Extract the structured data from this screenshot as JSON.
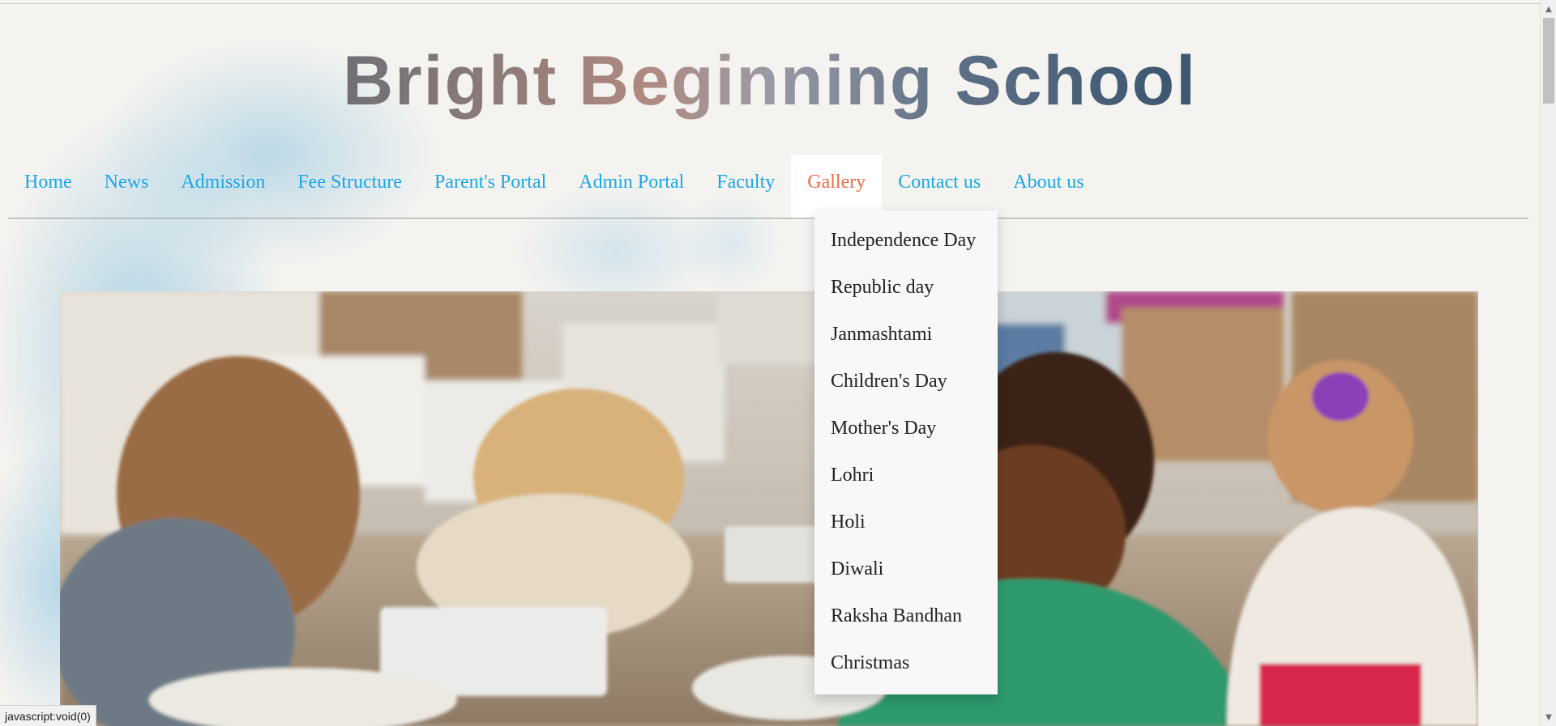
{
  "site": {
    "title": "Bright Beginning School"
  },
  "nav": {
    "items": [
      {
        "label": "Home"
      },
      {
        "label": "News"
      },
      {
        "label": "Admission"
      },
      {
        "label": "Fee Structure"
      },
      {
        "label": "Parent's Portal"
      },
      {
        "label": "Admin Portal"
      },
      {
        "label": "Faculty"
      },
      {
        "label": "Gallery",
        "active": true
      },
      {
        "label": "Contact us"
      },
      {
        "label": "About us"
      }
    ],
    "active_color": "#ee6b43",
    "link_color": "#1aa7e8"
  },
  "gallery_menu": {
    "items": [
      {
        "label": "Independence Day"
      },
      {
        "label": "Republic day"
      },
      {
        "label": "Janmashtami"
      },
      {
        "label": "Children's Day"
      },
      {
        "label": "Mother's Day"
      },
      {
        "label": "Lohri"
      },
      {
        "label": "Holi"
      },
      {
        "label": "Diwali"
      },
      {
        "label": "Raksha Bandhan"
      },
      {
        "label": "Christmas"
      }
    ]
  },
  "status_bar": {
    "text": "javascript:void(0)"
  }
}
